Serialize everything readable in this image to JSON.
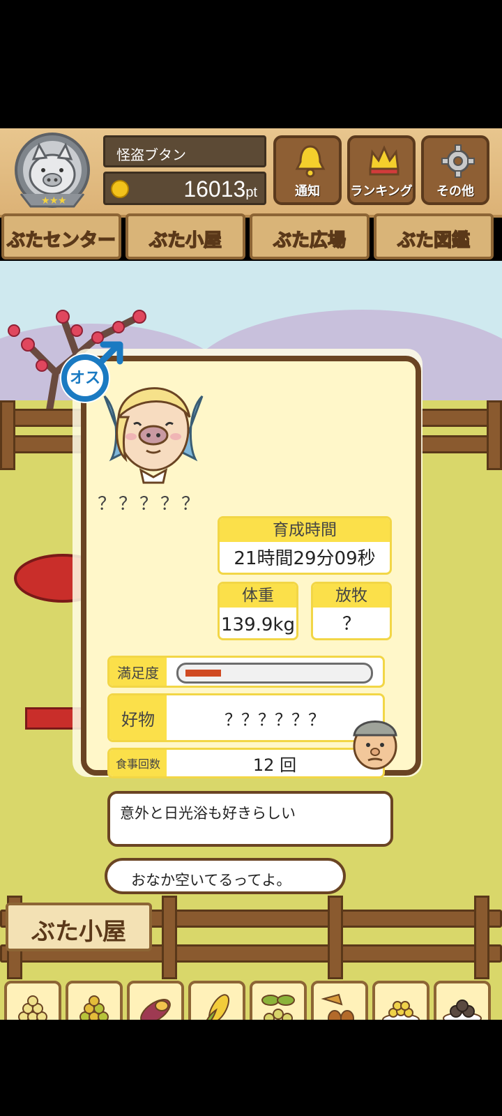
{
  "header": {
    "player_name": "怪盗ブタン",
    "points": "16013",
    "points_unit": "pt",
    "buttons": [
      {
        "label": "通知",
        "icon": "bell-icon"
      },
      {
        "label": "ランキング",
        "icon": "crown-icon"
      },
      {
        "label": "その他",
        "icon": "gear-icon"
      }
    ]
  },
  "tabs": [
    {
      "label": "ぶたセンター",
      "active": false
    },
    {
      "label": "ぶた小屋",
      "active": true
    },
    {
      "label": "ぶた広場",
      "active": false
    },
    {
      "label": "ぶた図鑑",
      "active": false
    }
  ],
  "pig": {
    "gender_label": "オス",
    "name": "？？？？？",
    "raising_time_label": "育成時間",
    "raising_time_value": "21時間29分09秒",
    "weight_label": "体重",
    "weight_value": "139.9kg",
    "grazing_label": "放牧",
    "grazing_value": "？",
    "satisfaction_label": "満足度",
    "satisfaction_level": 0.2,
    "favorite_label": "好物",
    "favorite_value": "？？？？？？",
    "meals_label": "食事回数",
    "meals_value": "12 回",
    "comment": "意外と日光浴も好きらしい",
    "farmer_message": "おなか空いてるってよ。"
  },
  "sign_label": "ぶた小屋",
  "foods": [
    {
      "name": "soybeans-icon"
    },
    {
      "name": "mixed-beans-icon"
    },
    {
      "name": "sweet-potato-icon"
    },
    {
      "name": "corn-icon"
    },
    {
      "name": "leafy-beans-icon"
    },
    {
      "name": "acorn-icon"
    },
    {
      "name": "bean-plate-icon"
    },
    {
      "name": "truffle-plate-icon"
    }
  ],
  "colors": {
    "wood": "#8e5f34",
    "panel_bg": "#fff7c9",
    "label_yellow": "#fbe04a",
    "gender_blue": "#1a7ac2",
    "gauge_fill": "#d04a22"
  }
}
